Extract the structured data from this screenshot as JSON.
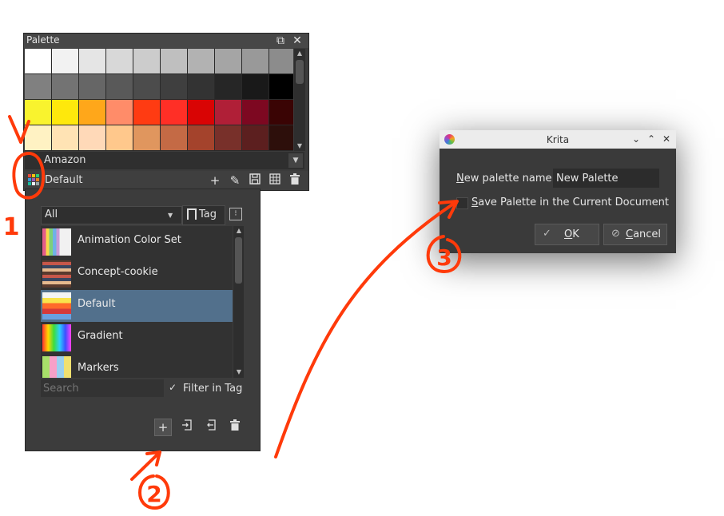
{
  "palette_docker": {
    "title": "Palette",
    "swatches": [
      "#ffffff",
      "#f2f2f2",
      "#e5e5e5",
      "#d8d8d8",
      "#cccccc",
      "#bfbfbf",
      "#b2b2b2",
      "#a5a5a5",
      "#999999",
      "#8c8c8c",
      "#808080",
      "#737373",
      "#666666",
      "#595959",
      "#4c4c4c",
      "#3f3f3f",
      "#333333",
      "#262626",
      "#191919",
      "#000000",
      "#f9f32e",
      "#fee80c",
      "#ffa71a",
      "#ff8c69",
      "#ff3b12",
      "#ff2f26",
      "#d90404",
      "#b01f37",
      "#7d0821",
      "#3a0404",
      "#fff2c3",
      "#ffe3b4",
      "#ffd9b8",
      "#ffc88c",
      "#e0965e",
      "#c46a45",
      "#a4432c",
      "#78302a",
      "#5c1f1f",
      "#2d0f0b"
    ],
    "palette_name_dropdown": "Amazon",
    "current_palette": "Default",
    "footer_icon_colors": [
      "#e74c3c",
      "#f1c40f",
      "#2ecc71",
      "#3498db",
      "#9b59b6",
      "#e67e22",
      "#1abc9c",
      "#ecf0f1",
      "#95a5a6"
    ]
  },
  "resource_popup": {
    "tag_filter": "All",
    "tag_button": "Tag",
    "items": [
      {
        "label": "Animation Color Set",
        "selected": false
      },
      {
        "label": "Concept-cookie",
        "selected": false
      },
      {
        "label": "Default",
        "selected": true
      },
      {
        "label": "Gradient",
        "selected": false
      },
      {
        "label": "Markers",
        "selected": false
      }
    ],
    "search_placeholder": "Search",
    "filter_in_tag": "Filter in Tag"
  },
  "krita_dialog": {
    "title": "Krita",
    "name_label_accel": "N",
    "name_label_rest": "ew palette name:",
    "name_value": "New Palette",
    "save_label_accel": "S",
    "save_label_rest": "ave Palette in the Current Document",
    "ok_accel": "O",
    "ok_rest": "K",
    "cancel_accel": "C",
    "cancel_rest": "ancel"
  },
  "annotations": {
    "step1": "1",
    "step2": "2",
    "step3": "3",
    "color": "#ff3a0a"
  }
}
